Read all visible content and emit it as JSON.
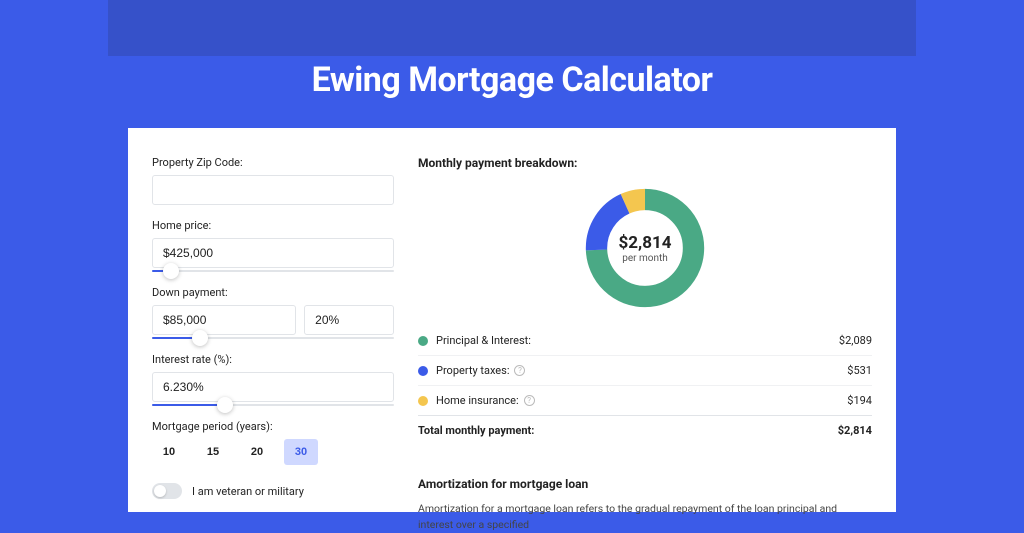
{
  "page": {
    "title": "Ewing Mortgage Calculator"
  },
  "form": {
    "zip": {
      "label": "Property Zip Code:",
      "value": ""
    },
    "price": {
      "label": "Home price:",
      "value": "$425,000",
      "slider_pct": 8
    },
    "down": {
      "label": "Down payment:",
      "value": "$85,000",
      "pct": "20%",
      "slider_pct": 20
    },
    "rate": {
      "label": "Interest rate (%):",
      "value": "6.230%",
      "slider_pct": 30
    },
    "period": {
      "label": "Mortgage period (years):",
      "options": [
        "10",
        "15",
        "20",
        "30"
      ],
      "selected": "30"
    },
    "veteran": {
      "label": "I am veteran or military",
      "on": false
    }
  },
  "breakdown": {
    "title": "Monthly payment breakdown:",
    "center": {
      "amount": "$2,814",
      "sub": "per month"
    },
    "items": [
      {
        "label": "Principal & Interest:",
        "value": "$2,089",
        "color": "#4aa985",
        "help": false
      },
      {
        "label": "Property taxes:",
        "value": "$531",
        "color": "#3b5be8",
        "help": true
      },
      {
        "label": "Home insurance:",
        "value": "$194",
        "color": "#f4c64f",
        "help": true
      }
    ],
    "total": {
      "label": "Total monthly payment:",
      "value": "$2,814"
    }
  },
  "chart_data": {
    "type": "pie",
    "title": "Monthly payment breakdown",
    "series": [
      {
        "name": "Principal & Interest",
        "value": 2089,
        "color": "#4aa985"
      },
      {
        "name": "Property taxes",
        "value": 531,
        "color": "#3b5be8"
      },
      {
        "name": "Home insurance",
        "value": 194,
        "color": "#f4c64f"
      }
    ],
    "total": 2814,
    "center_label": "$2,814 per month"
  },
  "amort": {
    "title": "Amortization for mortgage loan",
    "text": "Amortization for a mortgage loan refers to the gradual repayment of the loan principal and interest over a specified"
  }
}
